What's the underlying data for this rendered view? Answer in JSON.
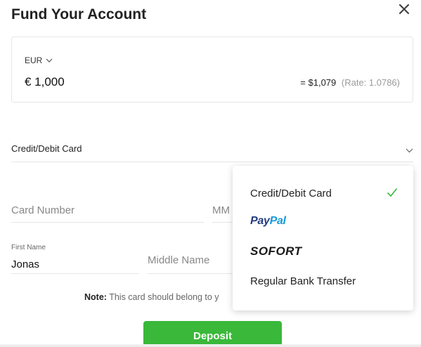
{
  "modal": {
    "title": "Fund Your Account"
  },
  "amount": {
    "currency": "EUR",
    "value": "€ 1,000",
    "converted": "= $1,079",
    "rate": "(Rate: 1.0786)"
  },
  "payment_method": {
    "selected": "Credit/Debit Card"
  },
  "form": {
    "card_number_placeholder": "Card Number",
    "mm_placeholder": "MM",
    "first_name_label": "First Name",
    "first_name_value": "Jonas",
    "middle_name_placeholder": "Middle Name",
    "note_label": "Note:",
    "note_text": " This card should belong to y"
  },
  "deposit_label": "Deposit",
  "dropdown": {
    "options": [
      {
        "label": "Credit/Debit Card",
        "selected": true
      },
      {
        "label_pay": "Pay",
        "label_pal": "Pal",
        "name": "PayPal"
      },
      {
        "label": "SOFORT"
      },
      {
        "label": "Regular Bank Transfer"
      }
    ]
  },
  "colors": {
    "accent": "#3ab83a",
    "paypal_dark": "#253b80",
    "paypal_light": "#179bd7"
  }
}
